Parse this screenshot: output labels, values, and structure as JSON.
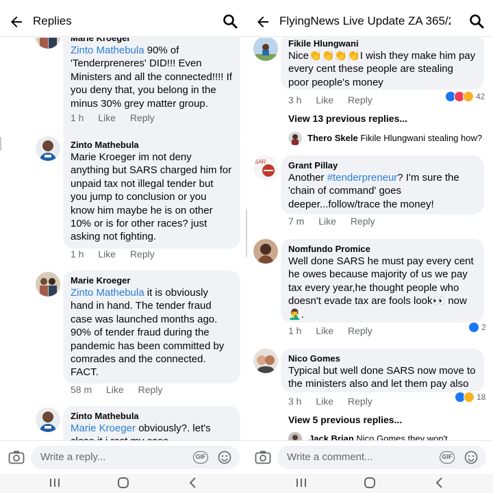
{
  "left": {
    "header": {
      "title": "Replies"
    },
    "comments": [
      {
        "author": "Marie Kroeger",
        "mention": "Zinto Mathebula",
        "text": " 90% of 'Tenderpreneres' DID!!! Even Ministers and all the connected!!!! If you deny that, you belong in the minus 30% grey matter group.",
        "time": "1 h",
        "like_label": "Like",
        "reply_label": "Reply"
      },
      {
        "author": "Zinto Mathebula",
        "text": "Marie Kroeger im not deny anything but SARS charged him for unpaid tax not illegal tender but you jump to conclusion or you know him maybe he is on other 10% or is for other races? just asking not fighting.",
        "time": "1 h",
        "like_label": "Like",
        "reply_label": "Reply"
      },
      {
        "author": "Marie Kroeger",
        "mention": "Zinto Mathebula",
        "text": " it is obviously hand in hand. The tender fraud case was launched months ago. 90% of tender fraud during the pandemic has been committed by comrades and the connected. FACT.",
        "time": "58 m",
        "like_label": "Like",
        "reply_label": "Reply"
      },
      {
        "author": "Zinto Mathebula",
        "mention": "Marie Kroeger",
        "text": " obviously?. let's close it i rest my case"
      }
    ],
    "composer": {
      "placeholder": "Write a reply...",
      "gif_label": "GIF"
    }
  },
  "right": {
    "header": {
      "title": "FlyingNews Live Update ZA 365/2..."
    },
    "comments": [
      {
        "author": "Fikile Hlungwani",
        "text_before": "Nice",
        "emoji": "👏👏👏👏",
        "text_after": "I wish they make him pay every cent these people are stealing poor people's money",
        "time": "3 h",
        "like_label": "Like",
        "reply_label": "Reply",
        "reactions": {
          "icons": [
            "like",
            "love",
            "haha"
          ],
          "count": "42"
        }
      },
      {
        "view_previous": "View 13 previous replies...",
        "reply_author": "Thero Skele",
        "reply_text": "Fikile Hlungwani stealing how?"
      },
      {
        "author": "Grant Pillay",
        "text_before": "Another ",
        "hashtag": "#tenderpreneur",
        "text_after": "? I'm sure the 'chain of command' goes deeper...follow/trace the money!",
        "time": "7 m",
        "like_label": "Like",
        "reply_label": "Reply"
      },
      {
        "author": "Nomfundo Promice",
        "text": "Well done SARS he must pay every cent he owes because majority of us we pay tax every year,he thought people who doesn't evade tax are fools look👀 now 🤦‍♂️.",
        "time": "1 h",
        "like_label": "Like",
        "reply_label": "Reply",
        "reactions": {
          "icons": [
            "like"
          ],
          "count": "2"
        }
      },
      {
        "author": "Nico Gomes",
        "text": "Typical but well done SARS now move to the ministers also and let them pay also",
        "time": "3 h",
        "like_label": "Like",
        "reply_label": "Reply",
        "reactions": {
          "icons": [
            "like",
            "haha"
          ],
          "count": "18"
        }
      },
      {
        "view_previous": "View 5 previous replies...",
        "reply_author": "Jack Brian",
        "reply_text": "Nico Gomes they won't"
      }
    ],
    "composer": {
      "placeholder": "Write a comment...",
      "gif_label": "GIF"
    }
  },
  "colors": {
    "bubble": "#f0f2f5",
    "mention": "#2d7fd4",
    "like_blue": "#1877f2",
    "love_red": "#f33e58",
    "haha_yellow": "#f7b125",
    "secondary_text": "#65676b"
  }
}
